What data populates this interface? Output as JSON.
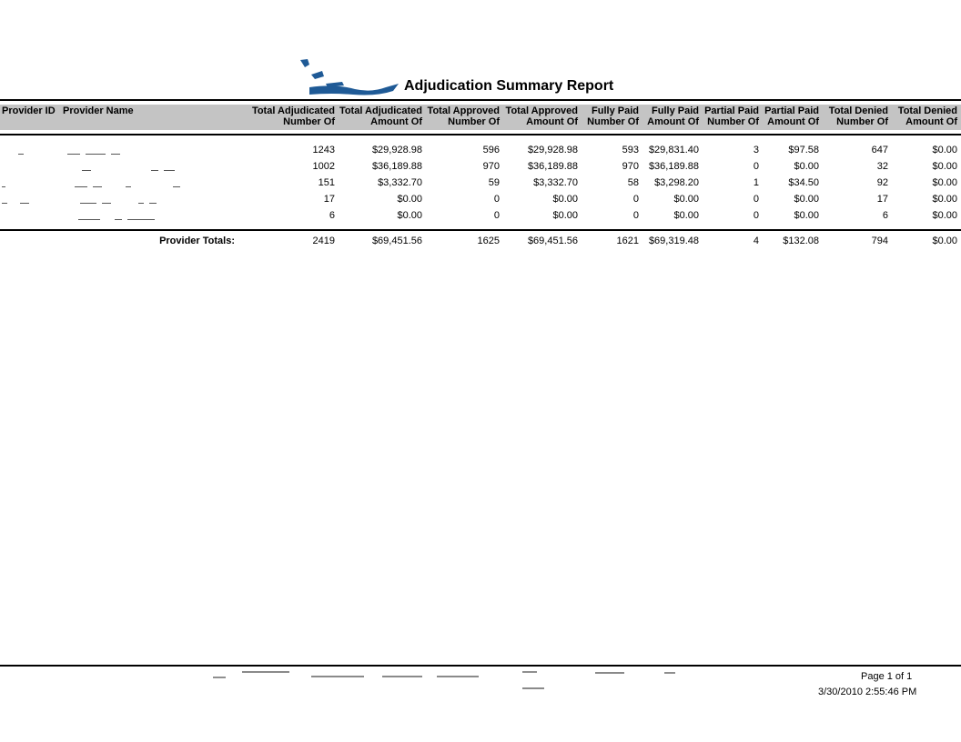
{
  "report": {
    "title": "Adjudication Summary Report"
  },
  "columns": {
    "provider_id": "Provider ID",
    "provider_name": "Provider Name",
    "numeric": [
      {
        "line1": "Total Adjudicated",
        "line2": "Number Of"
      },
      {
        "line1": "Total Adjudicated",
        "line2": "Amount Of"
      },
      {
        "line1": "Total Approved",
        "line2": "Number Of"
      },
      {
        "line1": "Total Approved",
        "line2": "Amount Of"
      },
      {
        "line1": "Fully Paid",
        "line2": "Number Of"
      },
      {
        "line1": "Fully Paid",
        "line2": "Amount Of"
      },
      {
        "line1": "Partial Paid",
        "line2": "Number Of"
      },
      {
        "line1": "Partial Paid",
        "line2": "Amount Of"
      },
      {
        "line1": "Total Denied",
        "line2": "Number Of"
      },
      {
        "line1": "Total Denied",
        "line2": "Amount Of"
      }
    ]
  },
  "rows": [
    {
      "values": [
        "1243",
        "$29,928.98",
        "596",
        "$29,928.98",
        "593",
        "$29,831.40",
        "3",
        "$97.58",
        "647",
        "$0.00"
      ]
    },
    {
      "values": [
        "1002",
        "$36,189.88",
        "970",
        "$36,189.88",
        "970",
        "$36,189.88",
        "0",
        "$0.00",
        "32",
        "$0.00"
      ]
    },
    {
      "values": [
        "151",
        "$3,332.70",
        "59",
        "$3,332.70",
        "58",
        "$3,298.20",
        "1",
        "$34.50",
        "92",
        "$0.00"
      ]
    },
    {
      "values": [
        "17",
        "$0.00",
        "0",
        "$0.00",
        "0",
        "$0.00",
        "0",
        "$0.00",
        "17",
        "$0.00"
      ]
    },
    {
      "values": [
        "6",
        "$0.00",
        "0",
        "$0.00",
        "0",
        "$0.00",
        "0",
        "$0.00",
        "6",
        "$0.00"
      ]
    }
  ],
  "totals": {
    "label": "Provider Totals:",
    "values": [
      "2419",
      "$69,451.56",
      "1625",
      "$69,451.56",
      "1621",
      "$69,319.48",
      "4",
      "$132.08",
      "794",
      "$0.00"
    ]
  },
  "footer": {
    "page": "Page 1 of 1",
    "timestamp": "3/30/2010 2:55:46 PM"
  },
  "colors": {
    "header_band": "#c4c4c4",
    "logo_blue": "#1f5a96"
  }
}
